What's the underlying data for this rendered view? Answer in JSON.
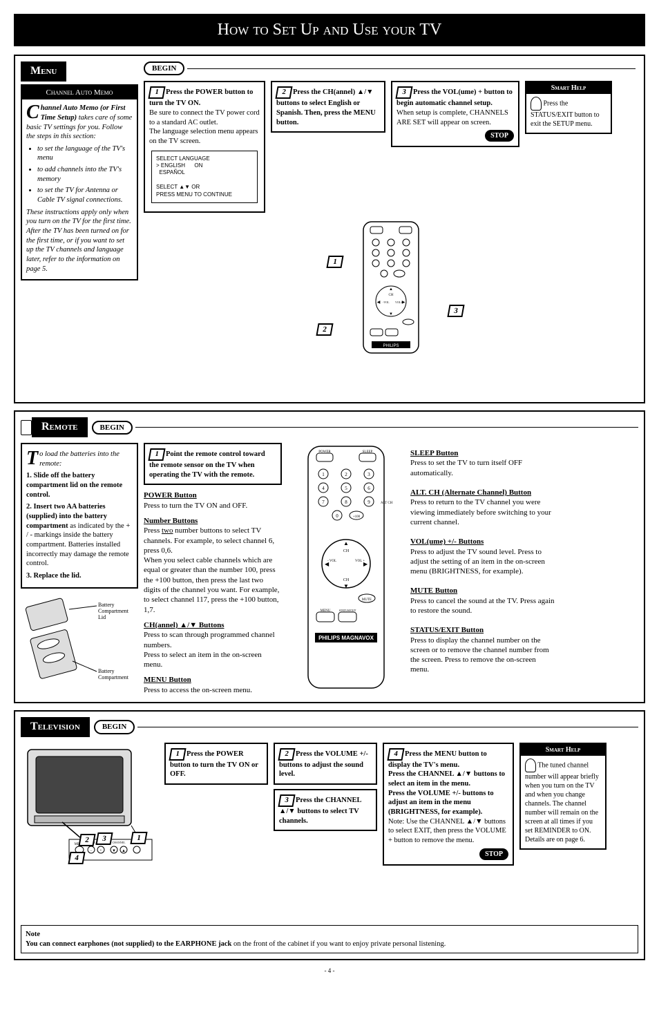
{
  "title": "How to Set Up and Use your TV",
  "menu": {
    "header": "Menu",
    "begin": "BEGIN",
    "stop": "STOP",
    "sidebox": {
      "sub": "Channel Auto Memo",
      "lead": "hannel Auto Memo (or First Time Setup)",
      "intro": " takes care of some basic TV settings for you. Follow the steps in this section:",
      "bullets": [
        "to set the language of the TV's menu",
        "to add channels into the TV's memory",
        "to set the TV for Antenna or Cable TV signal connections."
      ],
      "post": "These instructions apply only when you turn on the TV for the first time. After the TV has been turned on for the first time, or if you want to set up the TV channels and language later, refer to the information on page 5."
    },
    "step1": {
      "h": "Press the POWER button to turn the TV ON.",
      "b": "Be sure to connect the TV power cord to a standard AC outlet.",
      "b2": "The language selection menu appears on the TV screen.",
      "screen": "SELECT LANGUAGE\n> ENGLISH      ON\n  ESPAÑOL\n\nSELECT ▲▼ OR\nPRESS MENU TO CONTINUE"
    },
    "step2": {
      "h": "Press the CH(annel) ▲/▼ buttons to select English or Spanish. Then, press the MENU button."
    },
    "step3": {
      "h": "Press the VOL(ume) + button to begin automatic channel setup.",
      "b": "When setup is complete, CHANNELS ARE SET will appear on screen."
    },
    "smart": {
      "h": "Smart Help",
      "b": "Press the STATUS/EXIT button to exit the SETUP menu."
    }
  },
  "remote": {
    "header": "Remote",
    "begin": "BEGIN",
    "sidebox": {
      "lead": "o load the batteries into the remote:",
      "items": [
        "Slide off the battery compartment lid on the remote control.",
        "Insert two AA batteries (supplied) into the battery compartment as indicated by the + / - markings inside the battery compartment. Batteries installed incorrectly may damage the remote control.",
        "Replace the lid."
      ],
      "caption1": "Battery Compartment Lid",
      "caption2": "Battery Compartment"
    },
    "step1": "Point the remote control toward the remote sensor on the TV when operating the TV with the remote.",
    "power": {
      "h": "POWER Button",
      "b": "Press to turn the TV ON and OFF."
    },
    "num": {
      "h": "Number Buttons",
      "b": "Press two number buttons to select TV channels. For example, to select channel 6, press 0,6.",
      "b2": "When you select cable channels which are equal or greater than the number 100, press the +100 button, then press the last two digits of the channel you want. For example, to select channel 117, press the +100 button, 1,7."
    },
    "ch": {
      "h": "CH(annel) ▲/▼ Buttons",
      "b": "Press to scan through programmed channel numbers.",
      "b2": "Press to select an item in the on-screen menu."
    },
    "menubtn": {
      "h": "MENU Button",
      "b": "Press to access the on-screen menu."
    },
    "sleep": {
      "h": "SLEEP Button",
      "b": "Press to set the TV to turn itself OFF automatically."
    },
    "alt": {
      "h": "ALT. CH (Alternate Channel) Button",
      "b": "Press to return to the TV channel you were viewing immediately before switching to your current channel."
    },
    "vol": {
      "h": "VOL(ume) +/- Buttons",
      "b": "Press to adjust the TV sound level. Press to adjust the setting of an item in the on-screen menu (BRIGHTNESS, for example)."
    },
    "mute": {
      "h": "MUTE Button",
      "b": "Press to cancel the sound at the TV. Press again to restore the sound."
    },
    "status": {
      "h": "STATUS/EXIT Button",
      "b": "Press to display the channel number on the screen or to remove the channel number from the screen. Press to remove the on-screen menu."
    },
    "brand": "PHILIPS MAGNAVOX"
  },
  "tv": {
    "header": "Television",
    "begin": "BEGIN",
    "stop": "STOP",
    "step1": "Press the POWER button to turn the TV ON or OFF.",
    "step2": "Press the VOLUME +/- buttons to adjust the sound level.",
    "step3": "Press the CHANNEL ▲/▼ buttons to select TV channels.",
    "step4": {
      "a": "Press the MENU button to display the TV's menu.",
      "b": "Press the CHANNEL ▲/▼ buttons to select an item in the menu.",
      "c": "Press the VOLUME +/- buttons to adjust an item in the menu (BRIGHTNESS, for example).",
      "d": "Note: Use the CHANNEL ▲/▼ buttons to select EXIT, then press the VOLUME + button to remove the menu."
    },
    "smart": {
      "h": "Smart Help",
      "b": "The tuned channel number will appear briefly when you turn on the TV and when you change channels. The channel number will remain on the screen at all times if you set REMINDER to ON. Details are on page 6."
    },
    "note": {
      "h": "Note",
      "b": "You can connect earphones (not supplied) to the EARPHONE jack on the front of the cabinet if you want to enjoy private personal listening."
    }
  },
  "pagenum": "- 4 -"
}
